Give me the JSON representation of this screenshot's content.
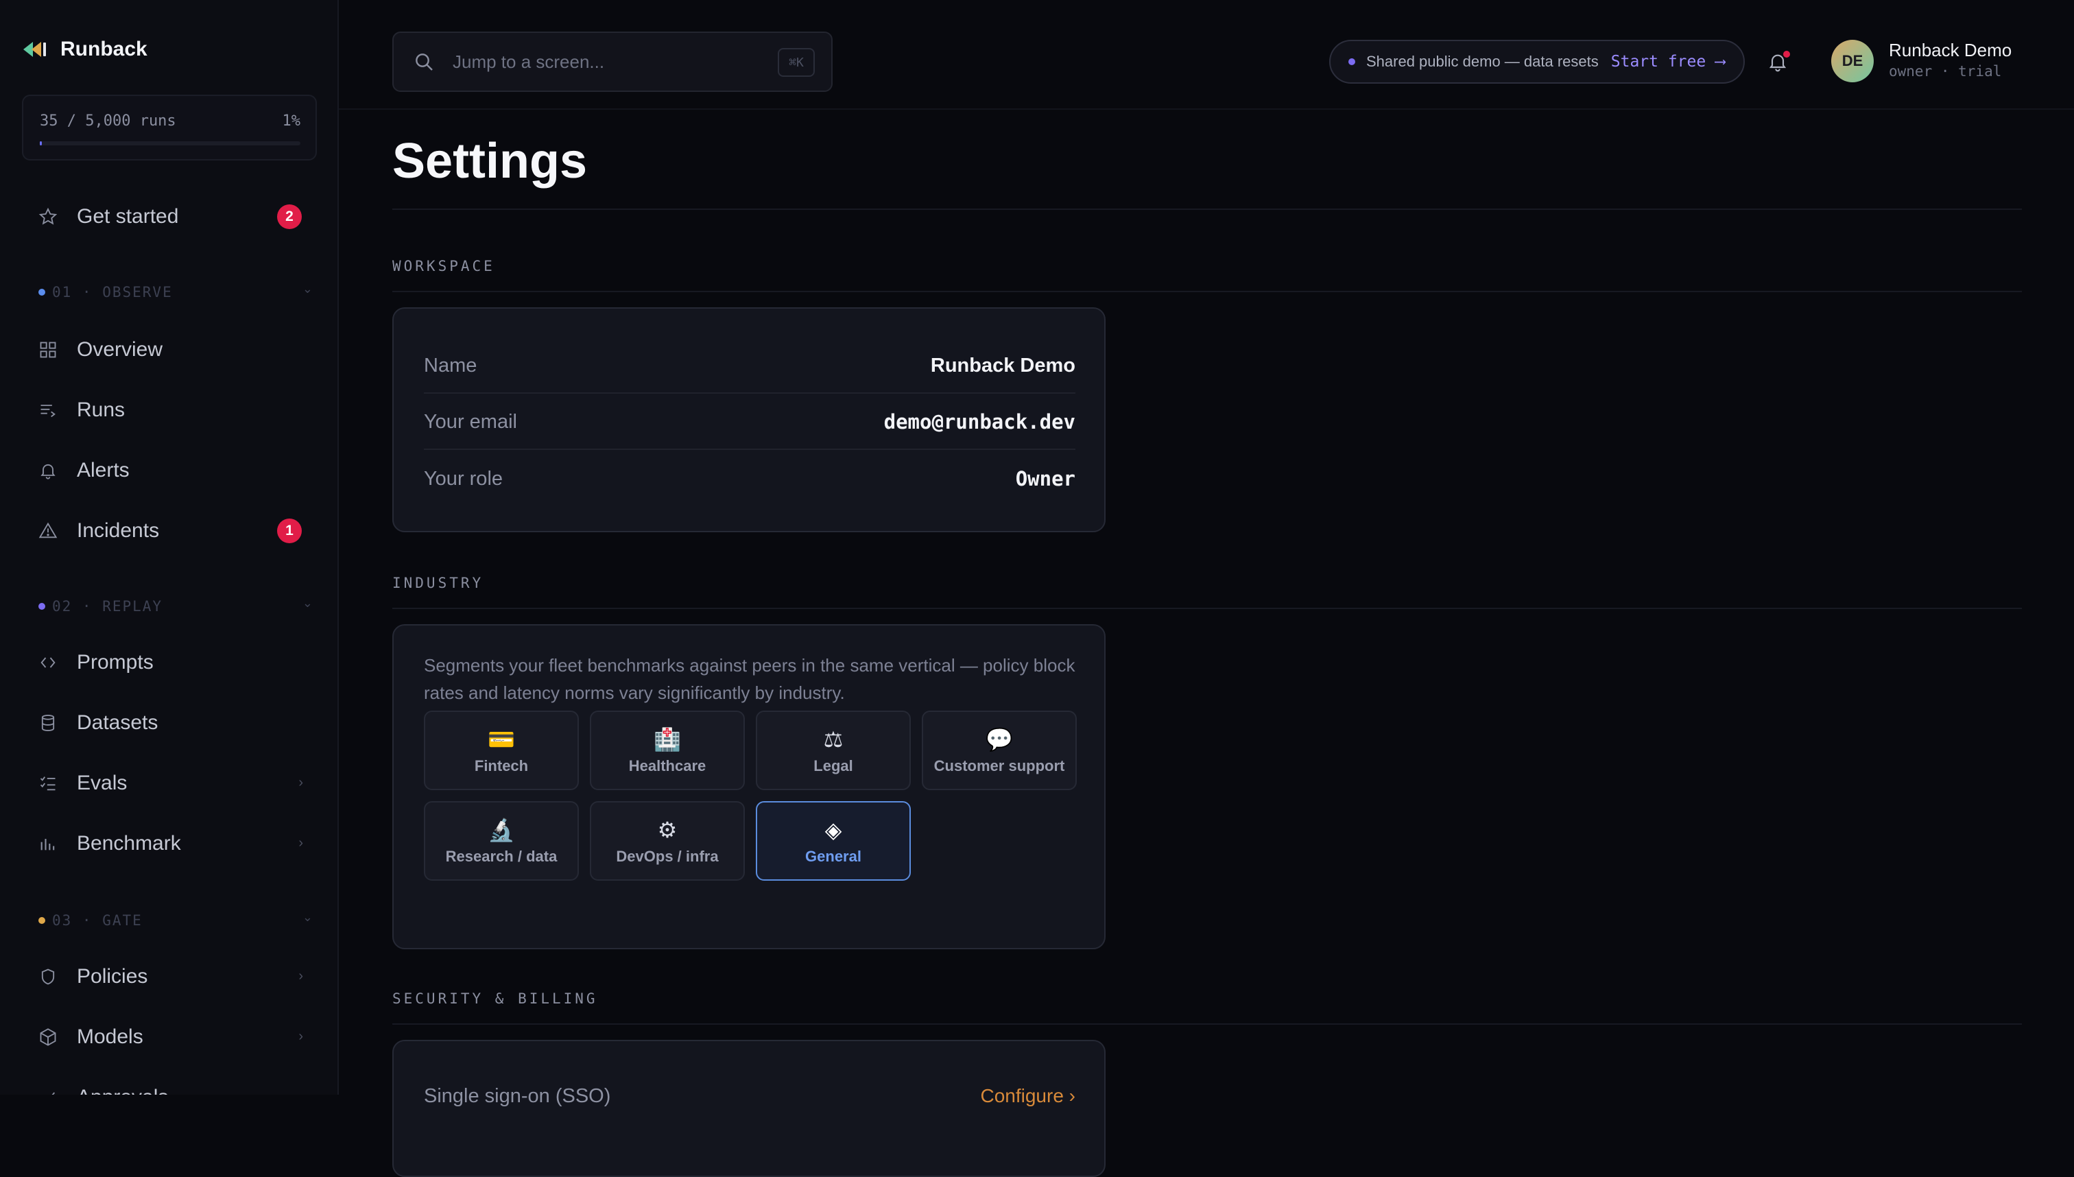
{
  "app": {
    "name": "Runback"
  },
  "usage": {
    "label": "35 / 5,000 runs",
    "percent_label": "1%",
    "fraction": 0.007
  },
  "sidebar": {
    "get_started": {
      "label": "Get started",
      "badge": "2"
    },
    "sections": [
      {
        "label": "01 · OBSERVE",
        "color": "#5b8dee"
      },
      {
        "label": "02 · REPLAY",
        "color": "#7c6cf2"
      },
      {
        "label": "03 · GATE",
        "color": "#e0a84a"
      }
    ],
    "items": [
      {
        "label": "Overview",
        "icon": "grid-icon"
      },
      {
        "label": "Runs",
        "icon": "list-arrow-icon"
      },
      {
        "label": "Alerts",
        "icon": "bell-icon"
      },
      {
        "label": "Incidents",
        "icon": "warning-icon",
        "badge": "1"
      },
      {
        "label": "Prompts",
        "icon": "code-brackets-icon"
      },
      {
        "label": "Datasets",
        "icon": "database-icon"
      },
      {
        "label": "Evals",
        "icon": "checklist-icon"
      },
      {
        "label": "Benchmark",
        "icon": "bar-chart-icon"
      },
      {
        "label": "Policies",
        "icon": "shield-icon"
      },
      {
        "label": "Models",
        "icon": "cube-icon"
      },
      {
        "label": "Approvals",
        "icon": "check-icon"
      }
    ]
  },
  "topbar": {
    "search_placeholder": "Jump to a screen...",
    "shortcut": "⌘K",
    "demo_notice": "Shared public demo — data resets",
    "demo_cta": "Start free ⟶",
    "user": {
      "initials": "DE",
      "name": "Runback Demo",
      "role": "owner · trial"
    }
  },
  "page": {
    "title": "Settings",
    "workspace": {
      "heading": "WORKSPACE",
      "rows": [
        {
          "key": "Name",
          "value": "Runback Demo"
        },
        {
          "key": "Your email",
          "value": "demo@runback.dev"
        },
        {
          "key": "Your role",
          "value": "Owner"
        }
      ]
    },
    "industry": {
      "heading": "INDUSTRY",
      "description": "Segments your fleet benchmarks against peers in the same vertical — policy block rates and latency norms vary significantly by industry.",
      "options": [
        {
          "label": "Fintech",
          "glyph": "💳"
        },
        {
          "label": "Healthcare",
          "glyph": "🏥"
        },
        {
          "label": "Legal",
          "glyph": "⚖"
        },
        {
          "label": "Customer support",
          "glyph": "💬"
        },
        {
          "label": "Research / data",
          "glyph": "🔬"
        },
        {
          "label": "DevOps / infra",
          "glyph": "⚙"
        },
        {
          "label": "General",
          "glyph": "◈"
        }
      ],
      "selected": "General"
    },
    "security": {
      "heading": "SECURITY & BILLING",
      "rows": [
        {
          "key": "Single sign-on (SSO)",
          "action": "Configure ›"
        }
      ]
    }
  }
}
